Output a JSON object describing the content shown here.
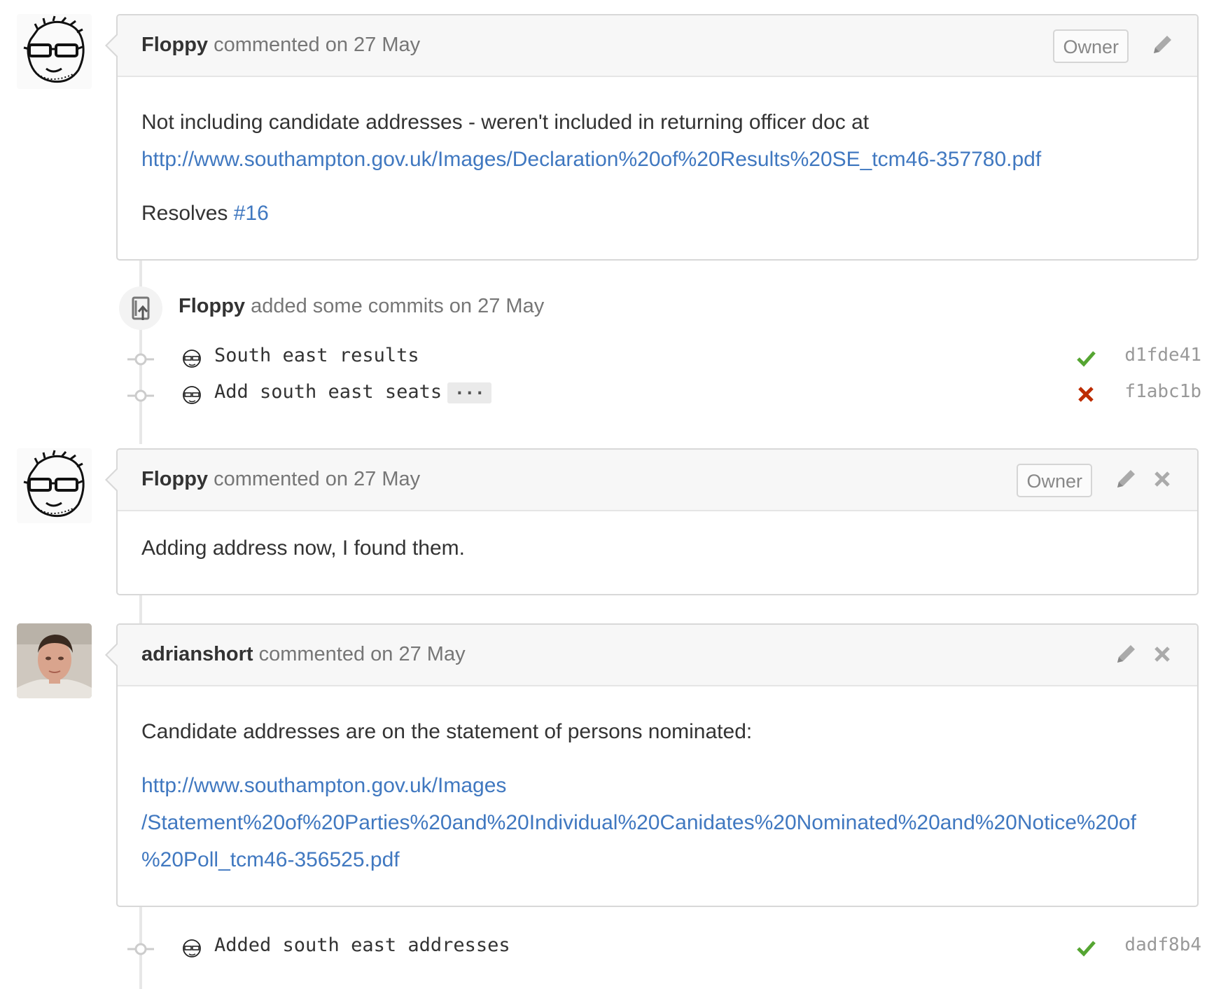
{
  "comments": [
    {
      "author": "Floppy",
      "action": "commented",
      "date": "on 27 May",
      "badge": "Owner",
      "body_line1": "Not including candidate addresses - weren't included in returning officer doc at",
      "body_link": "http://www.southampton.gov.uk/Images/Declaration%20of%20Results%20SE_tcm46-357780.pdf",
      "body_resolves": "Resolves",
      "body_issue": "#16"
    },
    {
      "author": "Floppy",
      "action": "commented",
      "date": "on 27 May",
      "badge": "Owner",
      "body": "Adding address now, I found them."
    },
    {
      "author": "adrianshort",
      "action": "commented",
      "date": "on 27 May",
      "body": "Candidate addresses are on the statement of persons nominated:",
      "link_line1": "http://www.southampton.gov.uk/Images",
      "link_line2": "/Statement%20of%20Parties%20and%20Individual%20Canidates%20Nominated%20and%20Notice%20of",
      "link_line3": "%20Poll_tcm46-356525.pdf"
    }
  ],
  "commit_event": {
    "author": "Floppy",
    "text": "added some commits on 27 May"
  },
  "commits": [
    {
      "message": "South east results",
      "status": "success",
      "sha": "d1fde41"
    },
    {
      "message": "Add south east seats",
      "ellipsis": "···",
      "status": "failure",
      "sha": "f1abc1b"
    },
    {
      "message": "Added south east addresses",
      "status": "success",
      "sha": "dadf8b4"
    }
  ],
  "colors": {
    "link": "#4078c0",
    "success": "#55a532",
    "failure": "#bd2c00"
  },
  "icons": {
    "edit": "pencil-icon",
    "delete": "close-icon",
    "commit_event": "repo-push-icon",
    "commit": "git-commit-icon"
  }
}
